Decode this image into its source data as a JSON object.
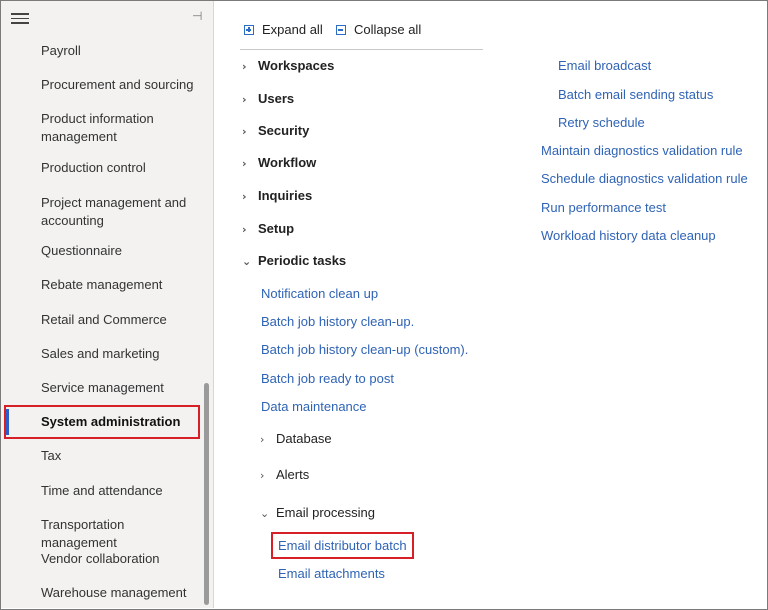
{
  "sidebar": {
    "items": [
      {
        "label": "Payroll"
      },
      {
        "label": "Procurement and sourcing"
      },
      {
        "label": "Product information management"
      },
      {
        "label": "Production control"
      },
      {
        "label": "Project management and accounting"
      },
      {
        "label": "Questionnaire"
      },
      {
        "label": "Rebate management"
      },
      {
        "label": "Retail and Commerce"
      },
      {
        "label": "Sales and marketing"
      },
      {
        "label": "Service management"
      },
      {
        "label": "System administration"
      },
      {
        "label": "Tax"
      },
      {
        "label": "Time and attendance"
      },
      {
        "label": "Transportation management"
      },
      {
        "label": "Vendor collaboration"
      },
      {
        "label": "Warehouse management"
      }
    ]
  },
  "toolbar": {
    "expand_all": "Expand all",
    "collapse_all": "Collapse all"
  },
  "tree": {
    "workspaces": "Workspaces",
    "users": "Users",
    "security": "Security",
    "workflow": "Workflow",
    "inquiries": "Inquiries",
    "setup": "Setup",
    "periodic_tasks": "Periodic tasks",
    "periodic_links": [
      "Notification clean up",
      "Batch job history clean-up.",
      "Batch job history clean-up (custom).",
      "Batch job ready to post",
      "Data maintenance"
    ],
    "database": "Database",
    "alerts": "Alerts",
    "email_processing": "Email processing",
    "email_links": [
      "Email distributor batch",
      "Email attachments",
      "Email broadcast",
      "Batch email sending status",
      "Retry schedule"
    ],
    "more_links": [
      "Maintain diagnostics validation rule",
      "Schedule diagnostics validation rule",
      "Run performance test",
      "Workload history data cleanup"
    ]
  }
}
